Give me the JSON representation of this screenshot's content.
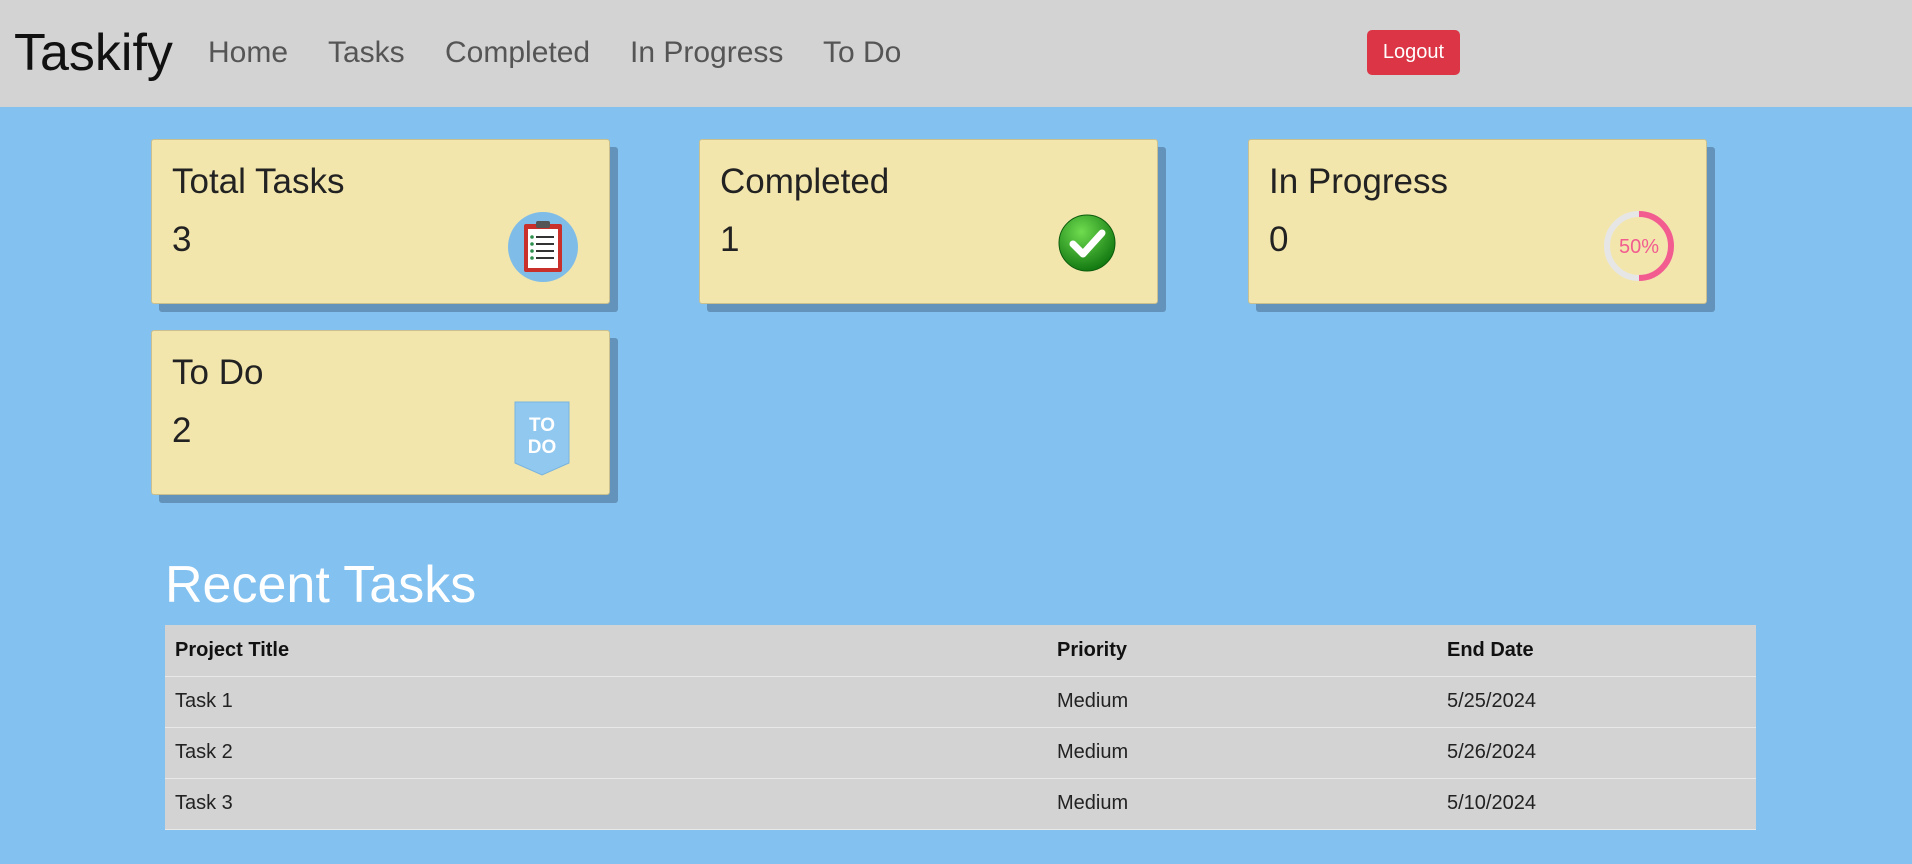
{
  "app": {
    "brand": "Taskify"
  },
  "nav": {
    "items": [
      {
        "label": "Home"
      },
      {
        "label": "Tasks"
      },
      {
        "label": "Completed"
      },
      {
        "label": "In Progress"
      },
      {
        "label": "To Do"
      }
    ],
    "logout_label": "Logout"
  },
  "stats": {
    "total": {
      "label": "Total Tasks",
      "value": "3",
      "icon": "clipboard-icon"
    },
    "completed": {
      "label": "Completed",
      "value": "1",
      "icon": "check-icon"
    },
    "in_progress": {
      "label": "In Progress",
      "value": "0",
      "icon": "progress-ring-icon",
      "icon_text": "50%"
    },
    "todo": {
      "label": "To Do",
      "value": "2",
      "icon": "todo-tag-icon",
      "icon_text_top": "TO",
      "icon_text_bottom": "DO"
    }
  },
  "recent": {
    "title": "Recent Tasks",
    "columns": [
      "Project Title",
      "Priority",
      "End Date"
    ],
    "rows": [
      [
        "Task 1",
        "Medium",
        "5/25/2024"
      ],
      [
        "Task 2",
        "Medium",
        "5/26/2024"
      ],
      [
        "Task 3",
        "Medium",
        "5/10/2024"
      ]
    ]
  },
  "colors": {
    "page_background": "#83c2f0",
    "navbar_background": "#d3d3d3",
    "card_background": "#f3e6ad",
    "logout_button": "#dc3545",
    "table_background": "#d3d3d3"
  }
}
